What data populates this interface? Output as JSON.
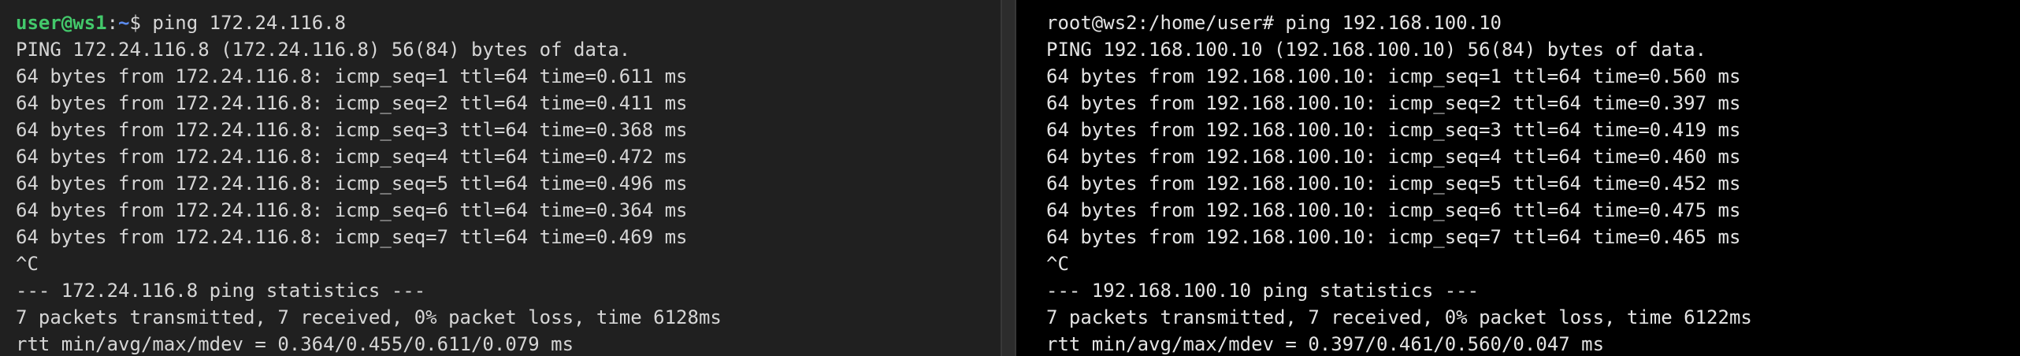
{
  "left_terminal": {
    "prompt": {
      "user_host": "user@ws1",
      "separator": ":",
      "path": "~",
      "symbol": "$",
      "command": " ping 172.24.116.8"
    },
    "lines": [
      "PING 172.24.116.8 (172.24.116.8) 56(84) bytes of data.",
      "64 bytes from 172.24.116.8: icmp_seq=1 ttl=64 time=0.611 ms",
      "64 bytes from 172.24.116.8: icmp_seq=2 ttl=64 time=0.411 ms",
      "64 bytes from 172.24.116.8: icmp_seq=3 ttl=64 time=0.368 ms",
      "64 bytes from 172.24.116.8: icmp_seq=4 ttl=64 time=0.472 ms",
      "64 bytes from 172.24.116.8: icmp_seq=5 ttl=64 time=0.496 ms",
      "64 bytes from 172.24.116.8: icmp_seq=6 ttl=64 time=0.364 ms",
      "64 bytes from 172.24.116.8: icmp_seq=7 ttl=64 time=0.469 ms",
      "^C",
      "--- 172.24.116.8 ping statistics ---",
      "7 packets transmitted, 7 received, 0% packet loss, time 6128ms",
      "rtt min/avg/max/mdev = 0.364/0.455/0.611/0.079 ms"
    ]
  },
  "right_terminal": {
    "prompt": {
      "text": "root@ws2:/home/user#",
      "command": " ping 192.168.100.10"
    },
    "lines": [
      "PING 192.168.100.10 (192.168.100.10) 56(84) bytes of data.",
      "64 bytes from 192.168.100.10: icmp_seq=1 ttl=64 time=0.560 ms",
      "64 bytes from 192.168.100.10: icmp_seq=2 ttl=64 time=0.397 ms",
      "64 bytes from 192.168.100.10: icmp_seq=3 ttl=64 time=0.419 ms",
      "64 bytes from 192.168.100.10: icmp_seq=4 ttl=64 time=0.460 ms",
      "64 bytes from 192.168.100.10: icmp_seq=5 ttl=64 time=0.452 ms",
      "64 bytes from 192.168.100.10: icmp_seq=6 ttl=64 time=0.475 ms",
      "64 bytes from 192.168.100.10: icmp_seq=7 ttl=64 time=0.465 ms",
      "^C",
      "--- 192.168.100.10 ping statistics ---",
      "7 packets transmitted, 7 received, 0% packet loss, time 6122ms",
      "rtt min/avg/max/mdev = 0.397/0.461/0.560/0.047 ms"
    ]
  },
  "colors": {
    "left_background": "#202020",
    "right_background": "#000000",
    "prompt_user_green": "#43c96b",
    "prompt_path_blue": "#5c8cf0",
    "text": "#d6d6d6"
  }
}
